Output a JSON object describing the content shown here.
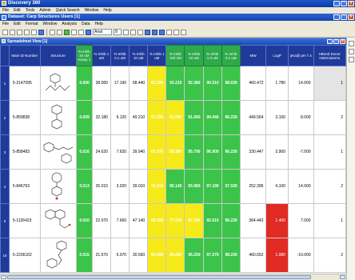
{
  "app": {
    "title": "Discovery 360"
  },
  "menu1": [
    "File",
    "Edit",
    "Tools",
    "Admin",
    "Quick Search",
    "Window",
    "Help"
  ],
  "doc": {
    "title": "Dataset: Carp Structures Users [1]"
  },
  "menu2": [
    "File",
    "Edit",
    "Format",
    "Window",
    "Analysis",
    "Data",
    "Help"
  ],
  "toolbar": {
    "font": "Arial",
    "size": "8"
  },
  "sheet": {
    "title": "Spreadsheet View [1]"
  },
  "columns": {
    "main_id": "Main ID Number",
    "structure": "Structure",
    "c1": "% Inhib 10 uM Assay 1",
    "c2": "% Inhib 1 uM",
    "c3": "% Inhib 0.1 uM",
    "c4": "% Inhib 10 uM",
    "c5": "% Inhib 1 uM",
    "c6": "% Inhib 100 nM",
    "c7": "% Inhib 10 uM",
    "c8": "% Inhib 1.0 uM",
    "c9": "% Inhib 0.1 uM",
    "mw": "MW",
    "logp": "LogP",
    "pka": "pKa@ pH 7.4",
    "hbd": "HBond Donor Heteroatoms"
  },
  "rows": [
    {
      "idx": "1",
      "id": "5-2147095",
      "v": [
        "0.000",
        "38.060",
        "17.190",
        "68.440",
        "82.290",
        "93.210",
        "92.380",
        "90.510",
        "98.630"
      ],
      "mw": "460.472",
      "logp": "1.780",
      "pka": "14.000",
      "hbd": "1"
    },
    {
      "idx": "2",
      "id": "5-859838",
      "v": [
        "0.009",
        "32.180",
        "6.120",
        "49.210",
        "57.290",
        "81.090",
        "91.690",
        "94.440",
        "96.230"
      ],
      "mw": "449.564",
      "logp": "3.100",
      "pka": "8.000",
      "hbd": "2"
    },
    {
      "idx": "3",
      "id": "5-858483",
      "v": [
        "0.016",
        "24.620",
        "7.620",
        "39.940",
        "67.870",
        "89.360",
        "95.790",
        "96.900",
        "96.230"
      ],
      "mw": "330.447",
      "logp": "3.900",
      "pka": "-7.000",
      "hbd": "1"
    },
    {
      "idx": "4",
      "id": "5-846763",
      "v": [
        "0.013",
        "26.010",
        "3.020",
        "39.010",
        "74.410",
        "85.140",
        "93.960",
        "97.190",
        "97.530"
      ],
      "mw": "252.395",
      "logp": "4.100",
      "pka": "14.000",
      "hbd": "2"
    },
    {
      "idx": "5",
      "id": "5-1126423",
      "v": [
        "0.010",
        "22.070",
        "7.660",
        "47.140",
        "66.250",
        "77.130",
        "87.790",
        "92.610",
        "96.230"
      ],
      "mw": "364.443",
      "logp": "1.400",
      "pka": "7.000",
      "hbd": "1"
    },
    {
      "idx": "10",
      "id": "5-2236162",
      "v": [
        "0.015",
        "21.570",
        "5.070",
        "30.560",
        "62.580",
        "84.250",
        "95.250",
        "97.270",
        "98.230"
      ],
      "mw": "460.652",
      "logp": "1.080",
      "pka": "-10.000",
      "hbd": "2"
    }
  ],
  "colors": {
    "green": "#3cc34a",
    "yellow": "#f6ea1a",
    "red": "#e02a22",
    "header": "#1f3a99"
  }
}
